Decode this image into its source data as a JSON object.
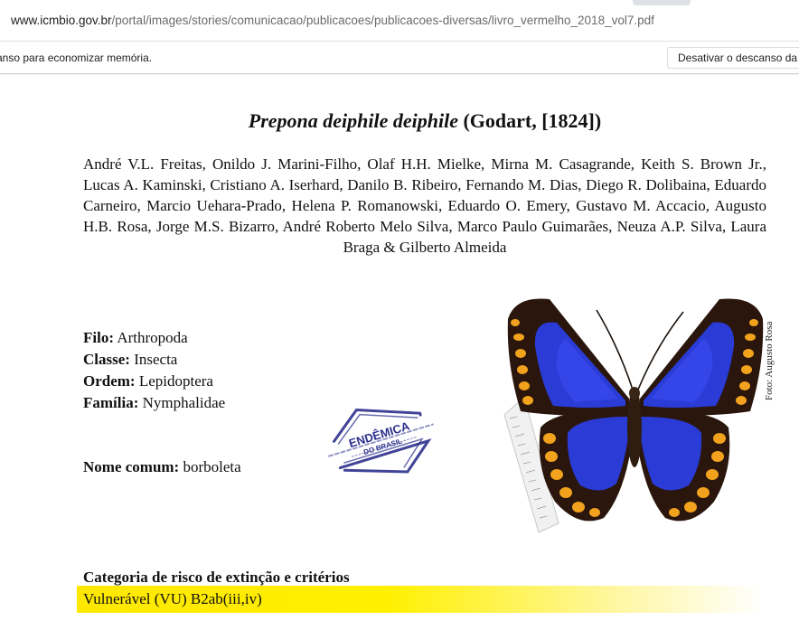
{
  "browser": {
    "url_host": "www.icmbio.gov.br",
    "url_path": "/portal/images/stories/comunicacao/publicacoes/publicacoes-diversas/livro_vermelho_2018_vol7.pdf",
    "infobar_text": "anso para economizar memória.",
    "infobar_button": "Desativar o descanso da g"
  },
  "document": {
    "title_species": "Prepona deiphile deiphile",
    "title_author": "(Godart, [1824])",
    "authors": "André V.L. Freitas, Onildo J. Marini-Filho, Olaf H.H. Mielke, Mirna M. Casagrande, Keith S. Brown Jr., Lucas A. Kaminski, Cristiano A. Iserhard, Danilo B. Ribeiro, Fernando M. Dias, Diego R. Dolibaina, Eduardo Carneiro, Marcio Uehara-Prado, Helena P. Romanowski, Eduardo O. Emery, Gustavo M. Accacio, Augusto H.B. Rosa, Jorge M.S. Bizarro, André Roberto Melo Silva, Marco Paulo Guimarães, Neuza A.P. Silva, Laura Braga & Gilberto Almeida",
    "taxonomy": [
      {
        "label": "Filo:",
        "value": "Arthropoda"
      },
      {
        "label": "Classe:",
        "value": "Insecta"
      },
      {
        "label": "Ordem:",
        "value": "Lepidoptera"
      },
      {
        "label": "Família:",
        "value": "Nymphalidae"
      }
    ],
    "common_name_label": "Nome comum:",
    "common_name_value": "borboleta",
    "stamp_text_1": "ENDÊMICA",
    "stamp_text_2": "DO BRASIL",
    "photo_credit": "Foto: Augusto Rosa",
    "category_heading": "Categoria de risco de extinção e critérios",
    "category_value": "Vulnerável (VU) B2ab(iii,iv)",
    "colors": {
      "highlight": "#fff000",
      "stamp_ink": "#2b2f8c",
      "wing_blue": "#2a3bd6",
      "wing_dark": "#2a160c",
      "wing_orange": "#f2a21c"
    }
  }
}
